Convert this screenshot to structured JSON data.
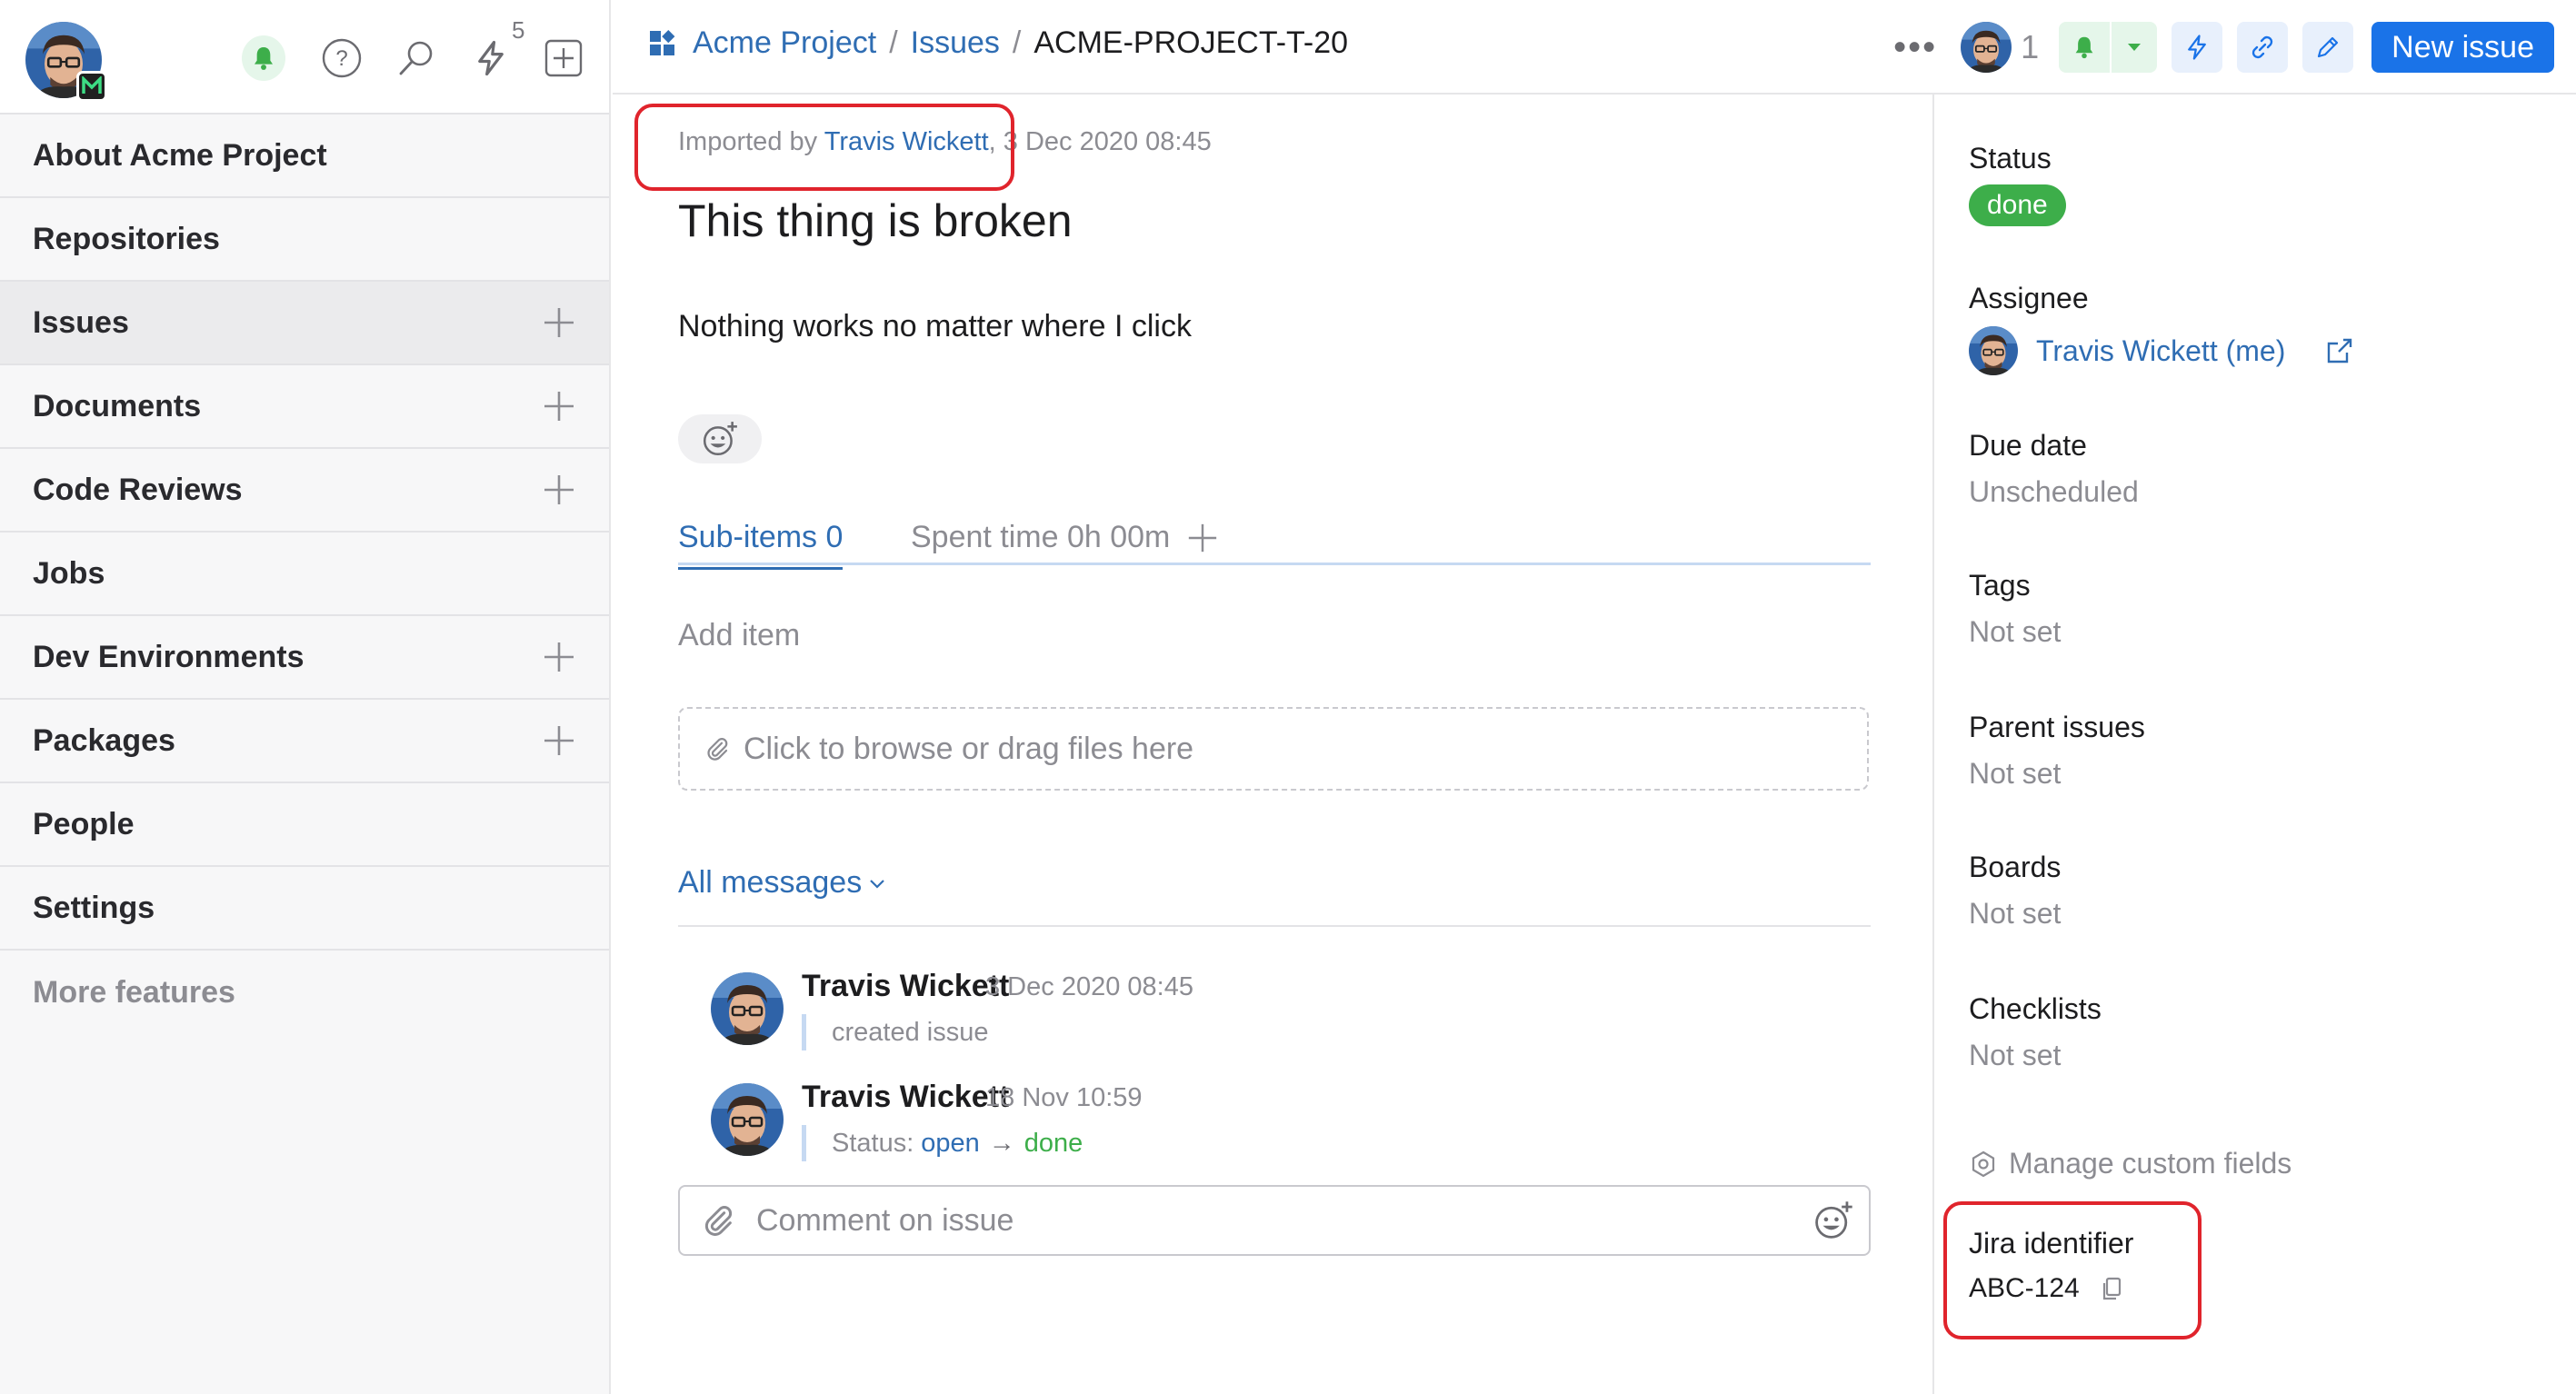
{
  "sidebar": {
    "notification_count": "5",
    "items": [
      {
        "label": "About Acme Project",
        "has_add": false,
        "active": false
      },
      {
        "label": "Repositories",
        "has_add": false,
        "active": false
      },
      {
        "label": "Issues",
        "has_add": true,
        "active": true
      },
      {
        "label": "Documents",
        "has_add": true,
        "active": false
      },
      {
        "label": "Code Reviews",
        "has_add": true,
        "active": false
      },
      {
        "label": "Jobs",
        "has_add": false,
        "active": false
      },
      {
        "label": "Dev Environments",
        "has_add": true,
        "active": false
      },
      {
        "label": "Packages",
        "has_add": true,
        "active": false
      },
      {
        "label": "People",
        "has_add": false,
        "active": false
      },
      {
        "label": "Settings",
        "has_add": false,
        "active": false
      }
    ],
    "more_features": "More features",
    "icons": [
      "avatar",
      "org-logo-icon",
      "bell-icon",
      "help-icon",
      "search-icon",
      "lightning-icon",
      "add-square-icon",
      "plus-icon"
    ]
  },
  "header": {
    "breadcrumb": {
      "project": "Acme Project",
      "section": "Issues",
      "separator": "/",
      "current": "ACME-PROJECT-T-20"
    },
    "more": "•••",
    "watchers_count": "1",
    "new_issue_label": "New issue",
    "accent_color": "#1a73e8"
  },
  "issue": {
    "imported_prefix": "Imported by",
    "imported_by": "Travis Wickett",
    "imported_date": ", 3 Dec 2020 08:45",
    "title": "This thing is broken",
    "description": "Nothing works no matter where I click",
    "tabs": {
      "subitems_label": "Sub-items",
      "subitems_count": "0",
      "spent_time": "Spent time 0h 00m"
    },
    "add_item_placeholder": "Add item",
    "dropzone_text": "Click to browse or drag files here",
    "all_messages": "All messages",
    "messages": [
      {
        "author": "Travis Wickett",
        "time": "3 Dec 2020 08:45",
        "body": "created issue"
      },
      {
        "author": "Travis Wickett",
        "time": "18 Nov 10:59",
        "status_prefix": "Status:",
        "from": "open",
        "arrow": "→",
        "to": "done"
      }
    ],
    "comment_placeholder": "Comment on issue"
  },
  "details": {
    "status_label": "Status",
    "status_value": "done",
    "status_color": "#3dae4a",
    "assignee_label": "Assignee",
    "assignee_value": "Travis Wickett (me)",
    "due_label": "Due date",
    "due_value": "Unscheduled",
    "tags_label": "Tags",
    "tags_value": "Not set",
    "parent_label": "Parent issues",
    "parent_value": "Not set",
    "boards_label": "Boards",
    "boards_value": "Not set",
    "checklists_label": "Checklists",
    "checklists_value": "Not set",
    "manage_fields": "Manage custom fields",
    "jira_label": "Jira identifier",
    "jira_value": "ABC-124"
  },
  "highlight_color": "#e0242c"
}
